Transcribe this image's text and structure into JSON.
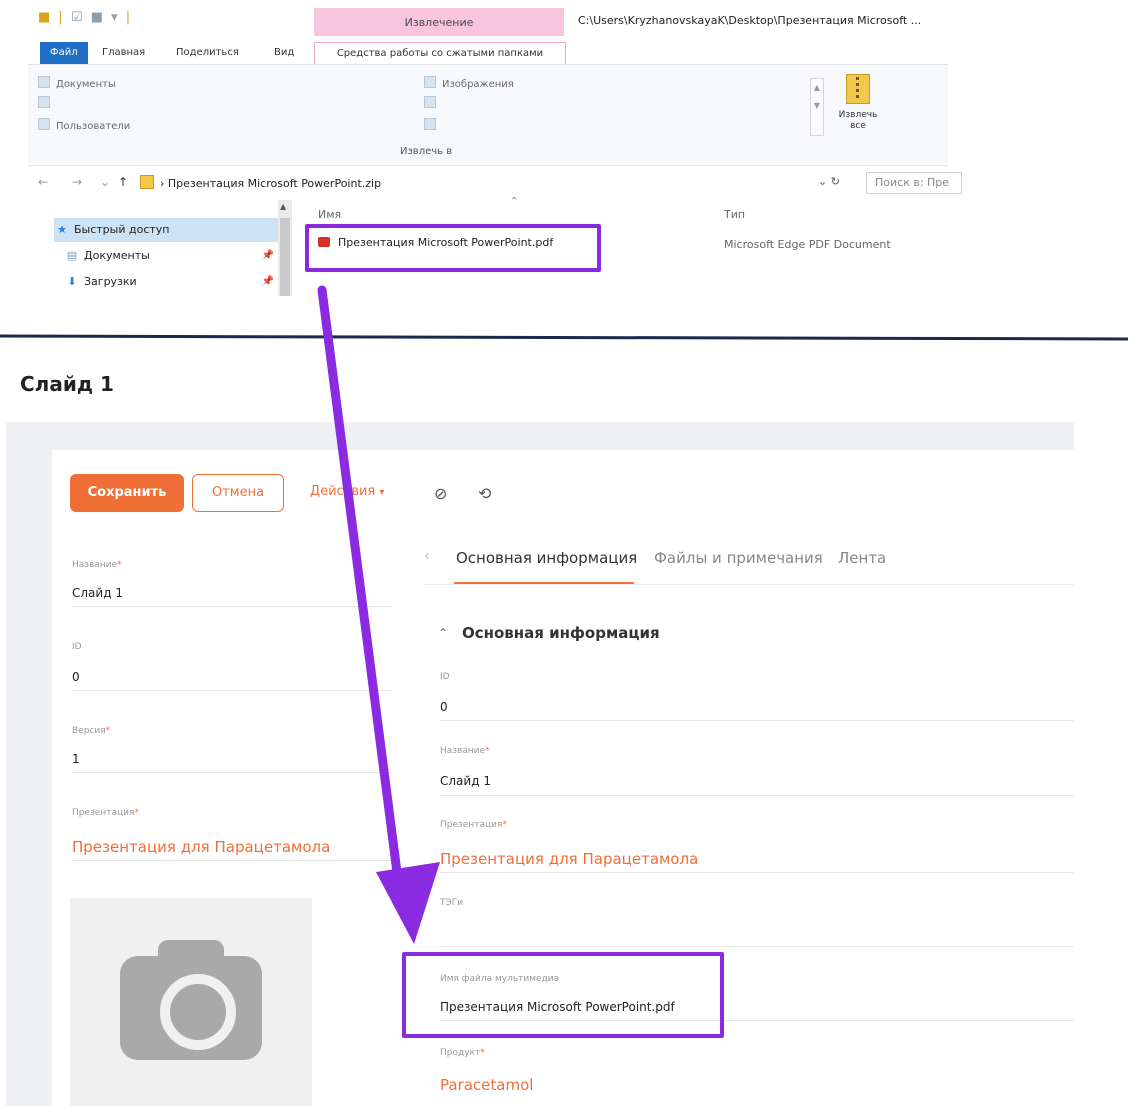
{
  "explorer": {
    "context_tab_header": "Извлечение",
    "window_path": "C:\\Users\\KryzhanovskayaK\\Desktop\\Презентация Microsoft ...",
    "ribbon_tabs": [
      "Файл",
      "Главная",
      "Поделиться",
      "Вид",
      "Средства работы со сжатыми папками"
    ],
    "locations_left": [
      "Документы",
      "Пользователи"
    ],
    "locations_right": [
      "Изображения"
    ],
    "group_label": "Извлечь в",
    "extract_all_line1": "Извлечь",
    "extract_all_line2": "все",
    "breadcrumb": "Презентация Microsoft PowerPoint.zip",
    "search_placeholder": "Поиск в: Пре",
    "nav": {
      "quick_access": "Быстрый доступ",
      "documents": "Документы",
      "downloads": "Загрузки"
    },
    "columns": {
      "name": "Имя",
      "type": "Тип"
    },
    "file": {
      "name": "Презентация Microsoft PowerPoint.pdf",
      "type": "Microsoft Edge PDF Document"
    }
  },
  "crm": {
    "page_title": "Слайд 1",
    "toolbar": {
      "save": "Сохранить",
      "cancel": "Отмена",
      "actions": "Действия"
    },
    "left_fields": [
      {
        "label": "Название",
        "required": true,
        "value": "Слайд 1"
      },
      {
        "label": "ID",
        "required": false,
        "value": "0"
      },
      {
        "label": "Версия",
        "required": true,
        "value": "1"
      },
      {
        "label": "Презентация",
        "required": true,
        "value": "Презентация для Парацетамола"
      }
    ],
    "tabs": [
      "Основная информация",
      "Файлы и примечания",
      "Лента"
    ],
    "section_title": "Основная информация",
    "right_fields": [
      {
        "label": "ID",
        "required": false,
        "value": "0"
      },
      {
        "label": "Название",
        "required": true,
        "value": "Слайд 1"
      },
      {
        "label": "Презентация",
        "required": true,
        "value": "Презентация для Парацетамола"
      },
      {
        "label": "ТЭГи",
        "required": false,
        "value": ""
      },
      {
        "label": "Имя файла мультимедиа",
        "required": false,
        "value": "Презентация Microsoft PowerPoint.pdf"
      },
      {
        "label": "Продукт",
        "required": true,
        "value": "Paracetamol"
      }
    ]
  },
  "colors": {
    "accent": "#f06f37",
    "highlight": "#8a2be2",
    "explorer_file_tab": "#1f6fc4",
    "context_tab": "#f7c5dc"
  }
}
